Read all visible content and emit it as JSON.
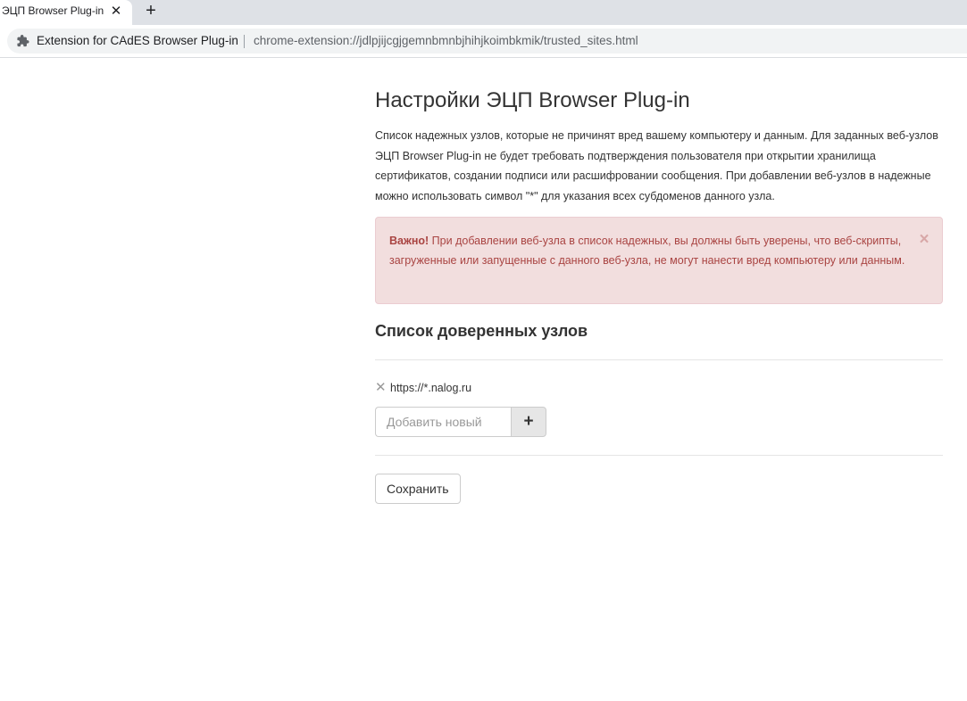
{
  "browser": {
    "tab_title": "ЭЦП Browser Plug-in",
    "tab_close_glyph": "✕",
    "new_tab_glyph": "+",
    "extension_name": "Extension for CAdES Browser Plug-in",
    "url": "chrome-extension://jdlpjijcgjgemnbmnbjhihjkoimbkmik/trusted_sites.html"
  },
  "page": {
    "title": "Настройки ЭЦП Browser Plug-in",
    "intro": "Список надежных узлов, которые не причинят вред вашему компьютеру и данным. Для заданных веб-узлов ЭЦП Browser Plug-in не будет требовать подтверждения пользователя при открытии хранилища сертификатов, создании подписи или расшифровании сообщения. При добавлении веб-узлов в надежные можно использовать символ \"*\" для указания всех субдоменов данного узла.",
    "alert": {
      "strong": "Важно!",
      "text": " При добавлении веб-узла в список надежных, вы должны быть уверены, что веб-скрипты, загруженные или запущенные с данного веб-узла, не могут нанести вред компьютеру или данным.",
      "close_glyph": "×"
    },
    "section_title": "Список доверенных узлов",
    "trusted_sites": [
      {
        "url": "https://*.nalog.ru"
      }
    ],
    "remove_glyph": "✕",
    "add_input": {
      "placeholder": "Добавить новый",
      "value": ""
    },
    "add_glyph": "+",
    "save_label": "Сохранить"
  },
  "colors": {
    "alert_bg": "#f2dede",
    "alert_text": "#a94442",
    "chrome_tabstrip": "#dee1e6",
    "omnibox_bg": "#f1f3f4"
  }
}
